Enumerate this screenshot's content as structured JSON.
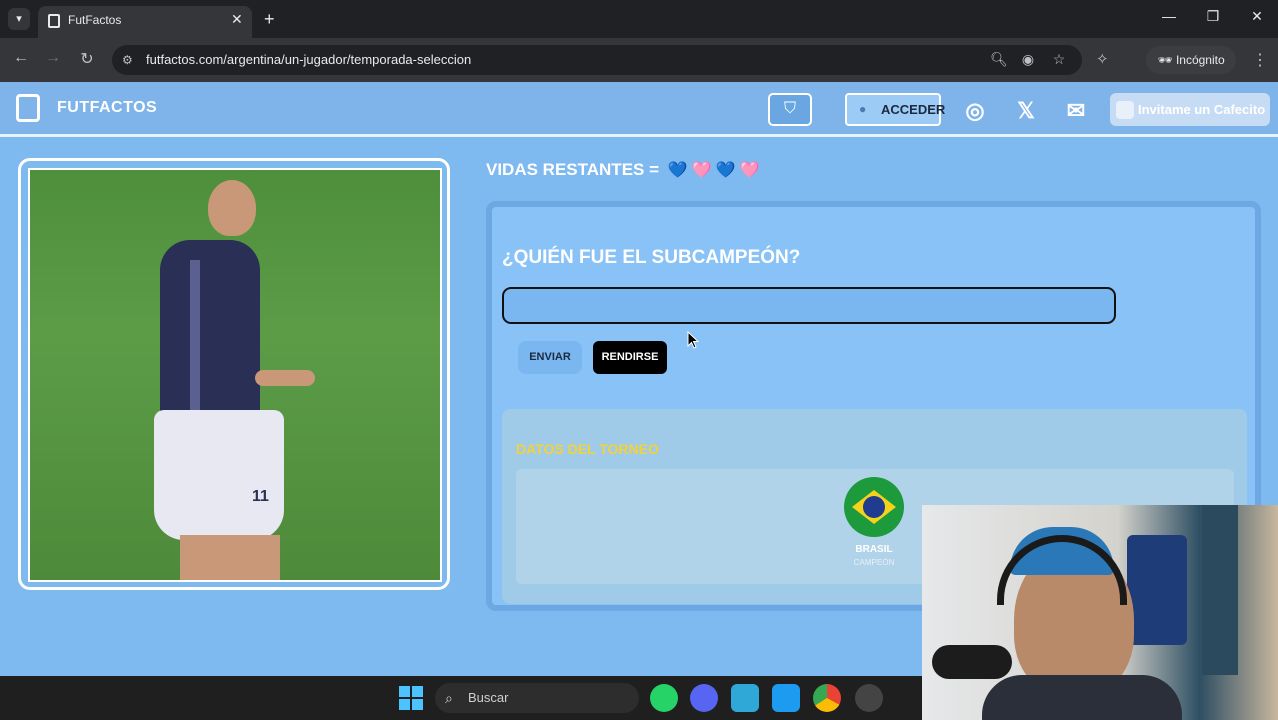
{
  "browser": {
    "tab_title": "FutFactos",
    "url": "futfactos.com/argentina/un-jugador/temporada-seleccion",
    "incognito_label": "Incógnito"
  },
  "site": {
    "brand": "FUTFACTOS",
    "login_label": "ACCEDER",
    "donate_label": "Invitame un Cafecito",
    "social_icons": [
      "instagram-icon",
      "x-icon",
      "mail-icon"
    ]
  },
  "game": {
    "lives_label": "VIDAS RESTANTES =",
    "lives": [
      "💙",
      "🩷",
      "💙",
      "🩷"
    ],
    "question": "¿QUIÉN FUE EL SUBCAMPEÓN?",
    "answer_value": "",
    "submit_label": "ENVIAR",
    "giveup_label": "RENDIRSE",
    "player_number": "11"
  },
  "tournament": {
    "title": "DATOS DEL TORNEO",
    "champion_country": "BRASIL",
    "champion_role": "CAMPEÓN"
  },
  "taskbar": {
    "search_label": "Buscar"
  },
  "colors": {
    "page_bg": "#7eb9f0",
    "panel_bg": "#88c2f6",
    "accent_yellow": "#f2d13a",
    "browser_dark": "#202124"
  }
}
